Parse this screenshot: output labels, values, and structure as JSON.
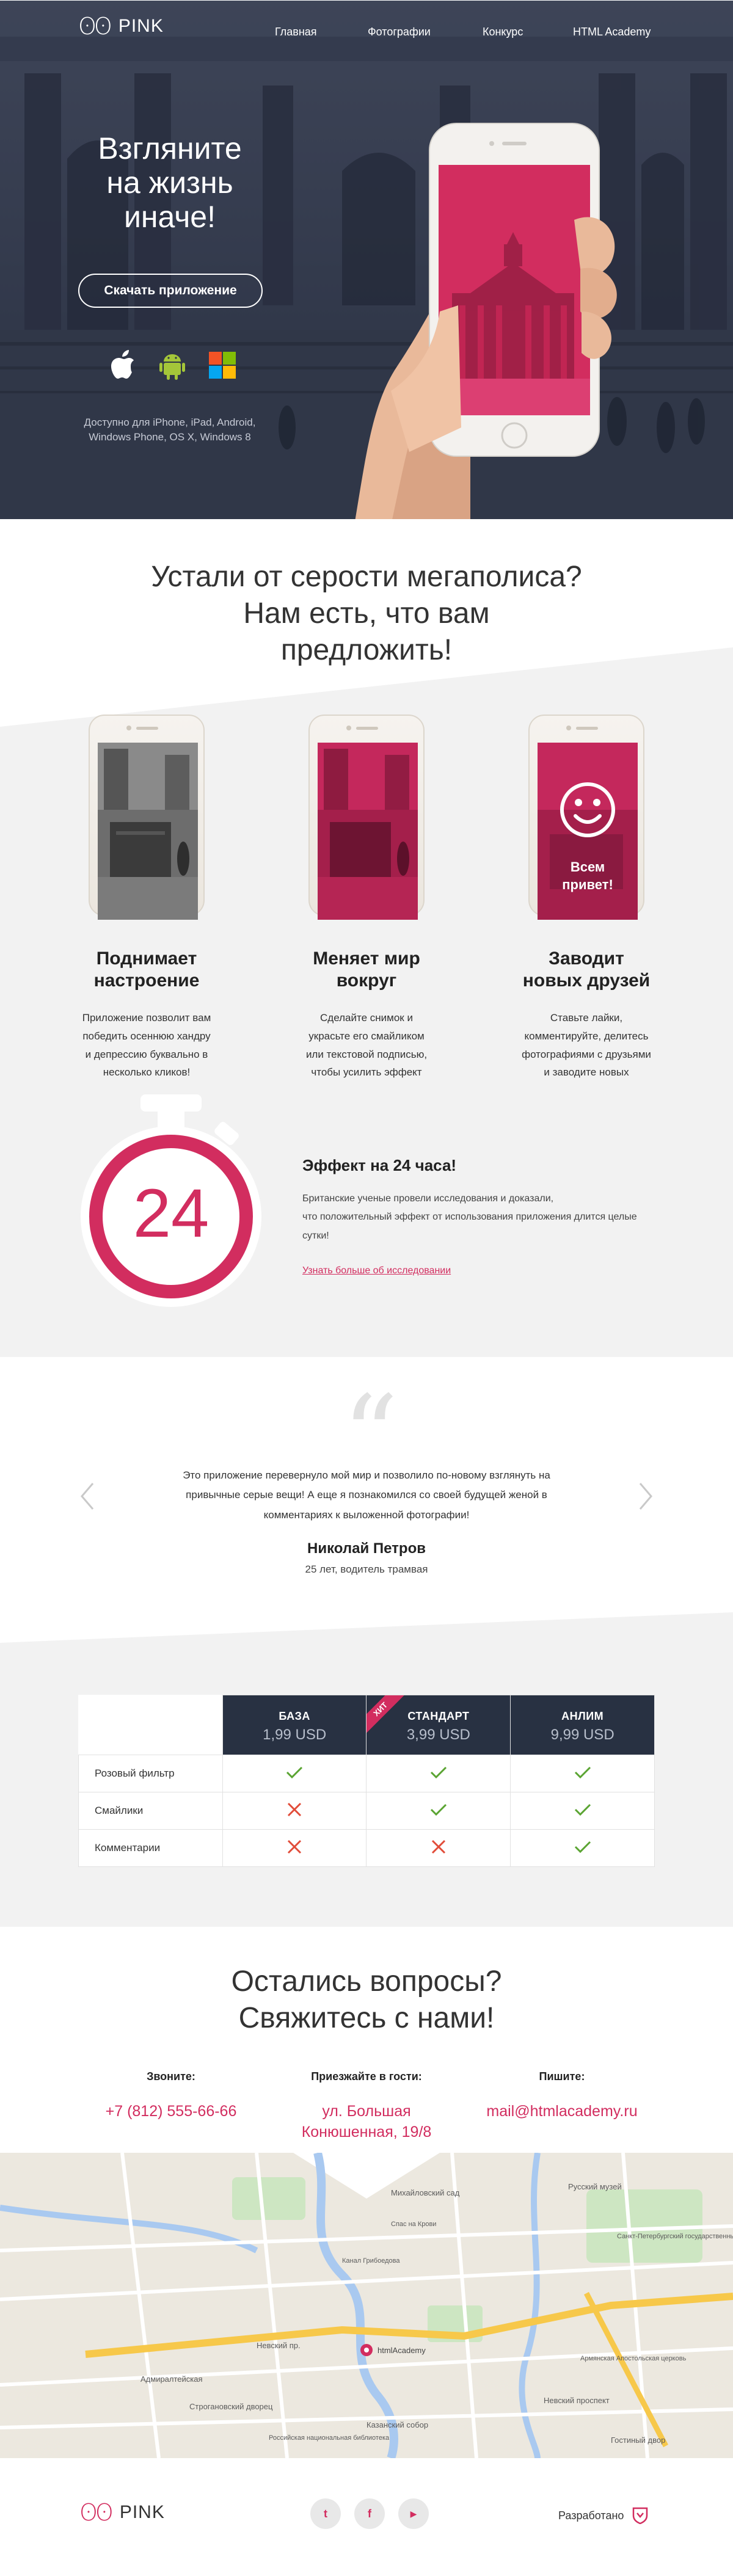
{
  "brand": {
    "logo_mark": "ʘʘ",
    "logo_text": "PINK"
  },
  "nav": {
    "items": [
      "Главная",
      "Фотографии",
      "Конкурс",
      "HTML Academy"
    ]
  },
  "hero": {
    "title": "Взгляните на жизнь иначе!",
    "button": "Скачать приложение",
    "os_icons": [
      "apple-icon",
      "android-icon",
      "windows-icon"
    ],
    "note": "Доступно для iPhone, iPad, Android, Windows Phone, OS X, Windows 8"
  },
  "features": {
    "title_line1": "Устали от серости мегаполиса?",
    "title_line2": "Нам есть, что вам",
    "title_line3": "предложить!",
    "items": [
      {
        "title_1": "Поднимает",
        "title_2": "настроение",
        "text_1": "Приложение позволит вам",
        "text_2": "победить осеннюю хандру",
        "text_3": "и депрессию буквально в",
        "text_4": "несколько кликов!"
      },
      {
        "title_1": "Меняет мир",
        "title_2": "вокруг",
        "text_1": "Сделайте снимок и",
        "text_2": "украсьте его смайликом",
        "text_3": "или текстовой подписью,",
        "text_4": "чтобы усилить эффект"
      },
      {
        "title_1": "Заводит",
        "title_2": "новых друзей",
        "text_1": "Ставьте лайки,",
        "text_2": "комментируйте, делитесь",
        "text_3": "фотографиями с друзьями",
        "text_4": "и заводите новых"
      }
    ],
    "phone3_caption_1": "Всем",
    "phone3_caption_2": "привет!"
  },
  "effect": {
    "timer_value": "24",
    "title": "Эффект на 24 часа!",
    "text_1": "Британские ученые провели исследования и доказали,",
    "text_2": "что положительный эффект от использования приложения длится целые",
    "text_3": "сутки!",
    "link": "Узнать больше об исследовании"
  },
  "review": {
    "quote_glyph": "“",
    "text_1": "Это приложение перевернуло мой мир и позволило по-новому взглянуть на",
    "text_2": "привычные серые вещи! А еще я познакомился со своей будущей женой в",
    "text_3": "комментариях к выложенной фотографии!",
    "name": "Николай Петров",
    "role": "25 лет, водитель трамвая"
  },
  "prices": {
    "plans": [
      {
        "name": "БАЗА",
        "price": "1,99 USD"
      },
      {
        "name": "СТАНДАРТ",
        "price": "3,99 USD",
        "badge": "ХИТ"
      },
      {
        "name": "АНЛИМ",
        "price": "9,99 USD"
      }
    ],
    "rows": [
      {
        "label": "Розовый фильтр",
        "values": [
          true,
          true,
          true
        ]
      },
      {
        "label": "Смайлики",
        "values": [
          false,
          true,
          true
        ]
      },
      {
        "label": "Комментарии",
        "values": [
          false,
          false,
          true
        ]
      }
    ],
    "colors": {
      "yes": "#5aa432",
      "no": "#e14c39",
      "header": "#283142",
      "accent": "#d22d5f"
    }
  },
  "contacts": {
    "title_1": "Остались вопросы?",
    "title_2": "Свяжитесь с нами!",
    "phone_label": "Звоните:",
    "phone": "+7 (812) 555-66-66",
    "address_label": "Приезжайте в гости:",
    "address_1": "ул. Большая",
    "address_2": "Конюшенная, 19/8",
    "email_label": "Пишите:",
    "email": "mail@htmlacademy.ru"
  },
  "map": {
    "labels": [
      "Русский музей",
      "Михайловский сад",
      "Невский пр.",
      "Адмиралтейская",
      "Строгановский дворец",
      "Казанский собор",
      "Гостиный двор",
      "Невский проспект",
      "Санкт-Петербургский государственный университет",
      "Армянская Апостольская церковь",
      "Российская национальная библиотека",
      "htmlAcademy",
      "Канал Грибоедова",
      "Спас на Крови"
    ],
    "marker_label": "htmlAcademy"
  },
  "footer": {
    "social": [
      "twitter-icon",
      "facebook-icon",
      "youtube-icon"
    ],
    "social_glyphs": [
      "t",
      "f",
      "▶"
    ],
    "made_by": "Разработано"
  }
}
